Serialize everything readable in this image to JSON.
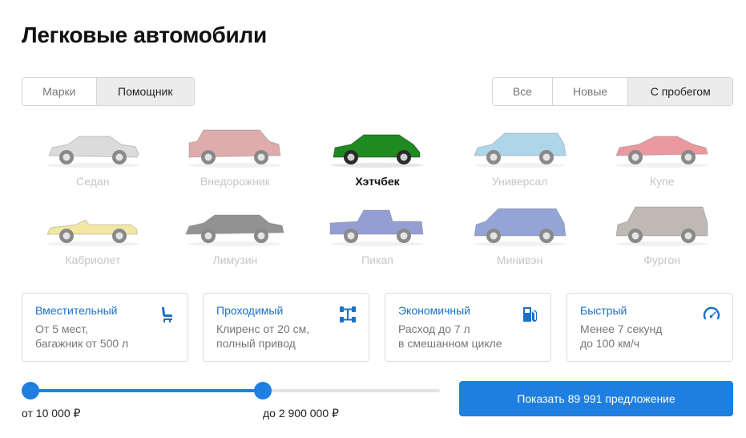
{
  "page": {
    "title": "Легковые автомобили"
  },
  "mode_switch": {
    "options": [
      "Марки",
      "Помощник"
    ],
    "selected": "Помощник"
  },
  "condition_switch": {
    "options": [
      "Все",
      "Новые",
      "С пробегом"
    ],
    "selected": "С пробегом"
  },
  "body_types": [
    {
      "label": "Седан",
      "icon": "sedan-icon",
      "color": "#bfbfbf",
      "active": false
    },
    {
      "label": "Внедорожник",
      "icon": "suv-icon",
      "color": "#c46a6a",
      "active": false
    },
    {
      "label": "Хэтчбек",
      "icon": "hatchback-icon",
      "color": "#1f8a1f",
      "active": true
    },
    {
      "label": "Универсал",
      "icon": "wagon-icon",
      "color": "#6cb5d6",
      "active": false
    },
    {
      "label": "Купе",
      "icon": "coupe-icon",
      "color": "#d9474f",
      "active": false
    },
    {
      "label": "Кабриолет",
      "icon": "cabriolet-icon",
      "color": "#e8d45a",
      "active": false
    },
    {
      "label": "Лимузин",
      "icon": "limousine-icon",
      "color": "#3a3a3a",
      "active": false
    },
    {
      "label": "Пикап",
      "icon": "pickup-icon",
      "color": "#3e4fb0",
      "active": false
    },
    {
      "label": "Минивэн",
      "icon": "minivan-icon",
      "color": "#3f5bb8",
      "active": false
    },
    {
      "label": "Фургон",
      "icon": "van-icon",
      "color": "#8a8276",
      "active": false
    }
  ],
  "features": [
    {
      "title": "Вместительный",
      "line1": "От 5 мест,",
      "line2": "багажник от 500 л",
      "icon": "car-seat-icon"
    },
    {
      "title": "Проходимый",
      "line1": "Клиренс от 20 см,",
      "line2": "полный привод",
      "icon": "drivetrain-icon"
    },
    {
      "title": "Экономичный",
      "line1": "Расход до 7 л",
      "line2": "в смешанном цикле",
      "icon": "fuel-pump-icon"
    },
    {
      "title": "Быстрый",
      "line1": "Менее 7 секунд",
      "line2": "до 100 км/ч",
      "icon": "speedometer-icon"
    }
  ],
  "price": {
    "from_label": "от 10 000 ₽",
    "to_label": "до 2 900 000 ₽",
    "from_fraction": 0.0,
    "to_fraction": 0.58
  },
  "cta": {
    "label": "Показать 89 991 предложение"
  },
  "colors": {
    "accent": "#1e7fe0",
    "link": "#1b6fc8"
  }
}
